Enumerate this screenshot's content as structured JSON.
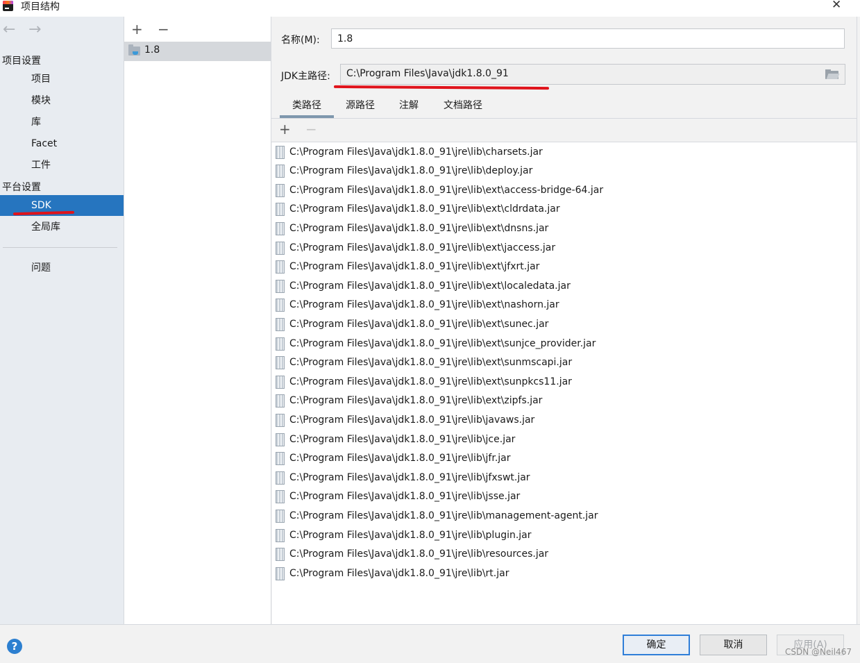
{
  "window": {
    "title": "项目结构",
    "close_glyph": "✕"
  },
  "nav": {
    "back_glyph": "←",
    "forward_glyph": "→",
    "project_settings_header": "项目设置",
    "project_items": [
      "项目",
      "模块",
      "库",
      "Facet",
      "工件"
    ],
    "platform_settings_header": "平台设置",
    "platform_items": [
      "SDK",
      "全局库"
    ],
    "selected_item": "SDK",
    "problems": "问题"
  },
  "sdk_list": {
    "add_glyph": "+",
    "remove_glyph": "−",
    "items": [
      "1.8"
    ],
    "selected": "1.8"
  },
  "detail": {
    "name_label": "名称(M):",
    "name_value": "1.8",
    "jdk_home_label": "JDK主路径:",
    "jdk_home_value": "C:\\Program Files\\Java\\jdk1.8.0_91",
    "tabs": [
      "类路径",
      "源路径",
      "注解",
      "文档路径"
    ],
    "active_tab": "类路径",
    "classpath_add_glyph": "+",
    "classpath_remove_glyph": "−",
    "classpath": [
      "C:\\Program Files\\Java\\jdk1.8.0_91\\jre\\lib\\charsets.jar",
      "C:\\Program Files\\Java\\jdk1.8.0_91\\jre\\lib\\deploy.jar",
      "C:\\Program Files\\Java\\jdk1.8.0_91\\jre\\lib\\ext\\access-bridge-64.jar",
      "C:\\Program Files\\Java\\jdk1.8.0_91\\jre\\lib\\ext\\cldrdata.jar",
      "C:\\Program Files\\Java\\jdk1.8.0_91\\jre\\lib\\ext\\dnsns.jar",
      "C:\\Program Files\\Java\\jdk1.8.0_91\\jre\\lib\\ext\\jaccess.jar",
      "C:\\Program Files\\Java\\jdk1.8.0_91\\jre\\lib\\ext\\jfxrt.jar",
      "C:\\Program Files\\Java\\jdk1.8.0_91\\jre\\lib\\ext\\localedata.jar",
      "C:\\Program Files\\Java\\jdk1.8.0_91\\jre\\lib\\ext\\nashorn.jar",
      "C:\\Program Files\\Java\\jdk1.8.0_91\\jre\\lib\\ext\\sunec.jar",
      "C:\\Program Files\\Java\\jdk1.8.0_91\\jre\\lib\\ext\\sunjce_provider.jar",
      "C:\\Program Files\\Java\\jdk1.8.0_91\\jre\\lib\\ext\\sunmscapi.jar",
      "C:\\Program Files\\Java\\jdk1.8.0_91\\jre\\lib\\ext\\sunpkcs11.jar",
      "C:\\Program Files\\Java\\jdk1.8.0_91\\jre\\lib\\ext\\zipfs.jar",
      "C:\\Program Files\\Java\\jdk1.8.0_91\\jre\\lib\\javaws.jar",
      "C:\\Program Files\\Java\\jdk1.8.0_91\\jre\\lib\\jce.jar",
      "C:\\Program Files\\Java\\jdk1.8.0_91\\jre\\lib\\jfr.jar",
      "C:\\Program Files\\Java\\jdk1.8.0_91\\jre\\lib\\jfxswt.jar",
      "C:\\Program Files\\Java\\jdk1.8.0_91\\jre\\lib\\jsse.jar",
      "C:\\Program Files\\Java\\jdk1.8.0_91\\jre\\lib\\management-agent.jar",
      "C:\\Program Files\\Java\\jdk1.8.0_91\\jre\\lib\\plugin.jar",
      "C:\\Program Files\\Java\\jdk1.8.0_91\\jre\\lib\\resources.jar",
      "C:\\Program Files\\Java\\jdk1.8.0_91\\jre\\lib\\rt.jar"
    ]
  },
  "buttons": {
    "help_glyph": "?",
    "ok": "确定",
    "cancel": "取消",
    "apply": "应用(A)"
  },
  "watermark": "CSDN @Neil467",
  "colors": {
    "selection": "#2675bf",
    "annotation_red": "#e0131b",
    "default_button_border": "#2f7ed8"
  }
}
